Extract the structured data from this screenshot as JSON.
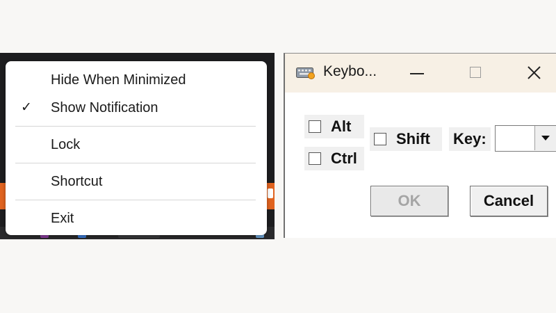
{
  "tray_menu": {
    "items": [
      {
        "label": "Hide When Minimized",
        "checked": false
      },
      {
        "label": "Show Notification",
        "checked": true
      },
      {
        "label": "Lock",
        "checked": false
      },
      {
        "label": "Shortcut",
        "checked": false
      },
      {
        "label": "Exit",
        "checked": false
      }
    ],
    "check_glyph": "✓"
  },
  "dialog": {
    "title": "Keybo...",
    "icon": "keyboard-icon",
    "checkboxes": {
      "alt": {
        "label": "Alt",
        "checked": false
      },
      "ctrl": {
        "label": "Ctrl",
        "checked": false
      },
      "shift": {
        "label": "Shift",
        "checked": false
      }
    },
    "key_label": "Key:",
    "key_value": "",
    "ok_label": "OK",
    "ok_enabled": false,
    "cancel_label": "Cancel"
  },
  "colors": {
    "taskbar": "#1d1d1f",
    "taskbar_accent": "#e0631f",
    "titlebar": "#f7f0e5",
    "disabled_text": "#a5a5a5"
  }
}
